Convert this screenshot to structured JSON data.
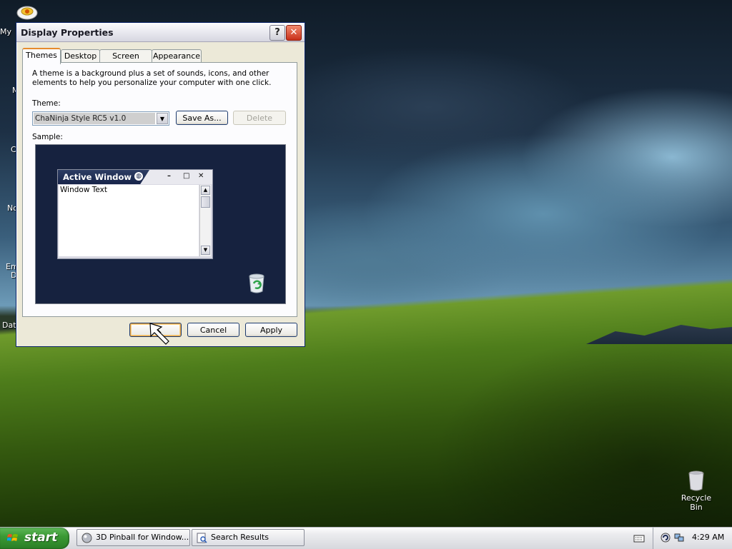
{
  "desktop": {
    "left_labels": [
      "My",
      "M",
      "C",
      "No",
      "Em",
      "D",
      "Dat"
    ],
    "recycle_bin_label": "Recycle Bin"
  },
  "window": {
    "title": "Display Properties",
    "help_button_label": "?",
    "close_button_label": "✕",
    "tabs": [
      {
        "label": "Themes",
        "active": true
      },
      {
        "label": "Desktop",
        "active": false
      },
      {
        "label": "Screen Saver",
        "active": false
      },
      {
        "label": "Appearance",
        "active": false
      }
    ],
    "intro_text": "A theme is a background plus a set of sounds, icons, and other elements to help you personalize your computer with one click.",
    "theme_label": "Theme:",
    "theme_value": "ChaNinja Style RC5 v1.0",
    "save_as_label": "Save As...",
    "delete_label": "Delete",
    "sample_label": "Sample:",
    "sample": {
      "window_title": "Active Window",
      "window_text": "Window Text",
      "minimize_glyph": "–",
      "maximize_glyph": "□",
      "close_glyph": "✕"
    },
    "ok_label": "OK",
    "cancel_label": "Cancel",
    "apply_label": "Apply"
  },
  "taskbar": {
    "start_label": "start",
    "tasks": [
      {
        "label": "3D Pinball for Window...",
        "icon": "pinball-icon"
      },
      {
        "label": "Search Results",
        "icon": "search-results-icon"
      }
    ],
    "clock": "4:29 AM"
  },
  "colors": {
    "start_green": "#3b9a35",
    "sample_background": "#16223f",
    "active_tab_accent": "#e68b2c"
  }
}
